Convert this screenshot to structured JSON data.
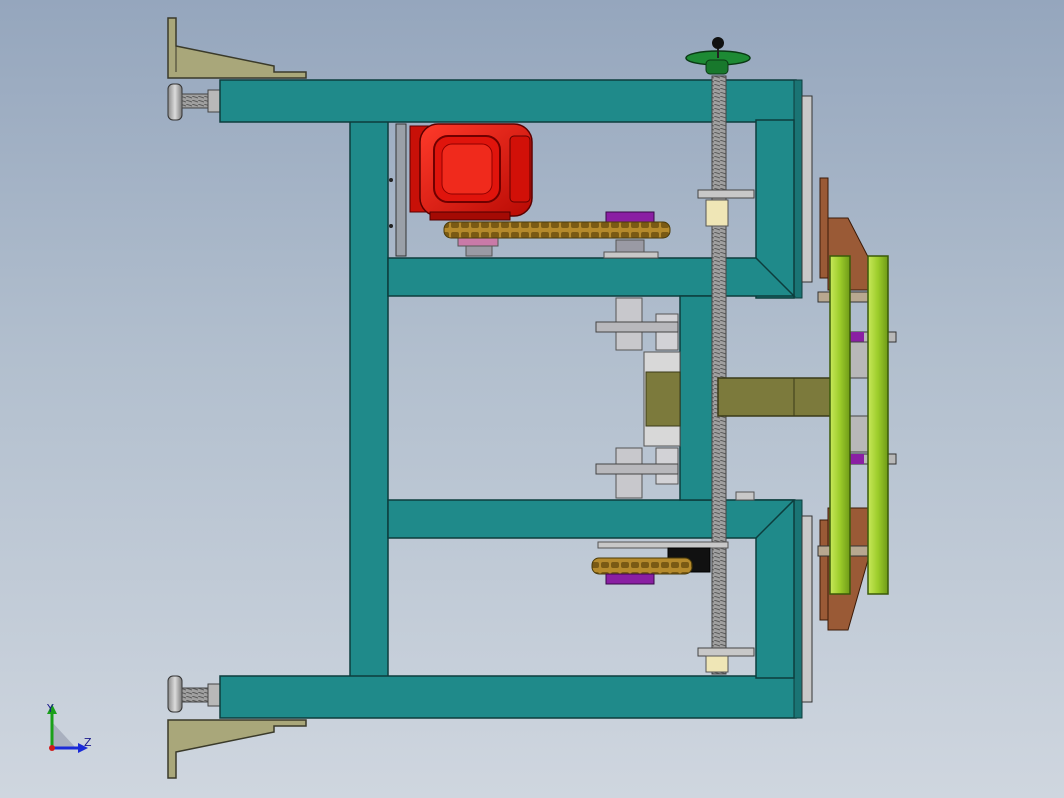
{
  "colors": {
    "frame": "#1f8a8a",
    "frame_edge": "#0d3d3d",
    "motor": "#e0140c",
    "olive": "#7c7a3c",
    "bracket": "#a9a77a",
    "green_rod": "#9ccc2a",
    "brown_plate": "#9a5a36",
    "purple": "#8a1fa3",
    "chain": "#b58a2c",
    "handwheel": "#1d8a34",
    "background_top": "#95a6bd",
    "background_bottom": "#cfd6df"
  },
  "icons": {
    "triad": "coordinate-triad-icon",
    "handwheel": "handwheel-icon"
  },
  "triad": {
    "y_label": "Y",
    "z_label": "Z"
  }
}
